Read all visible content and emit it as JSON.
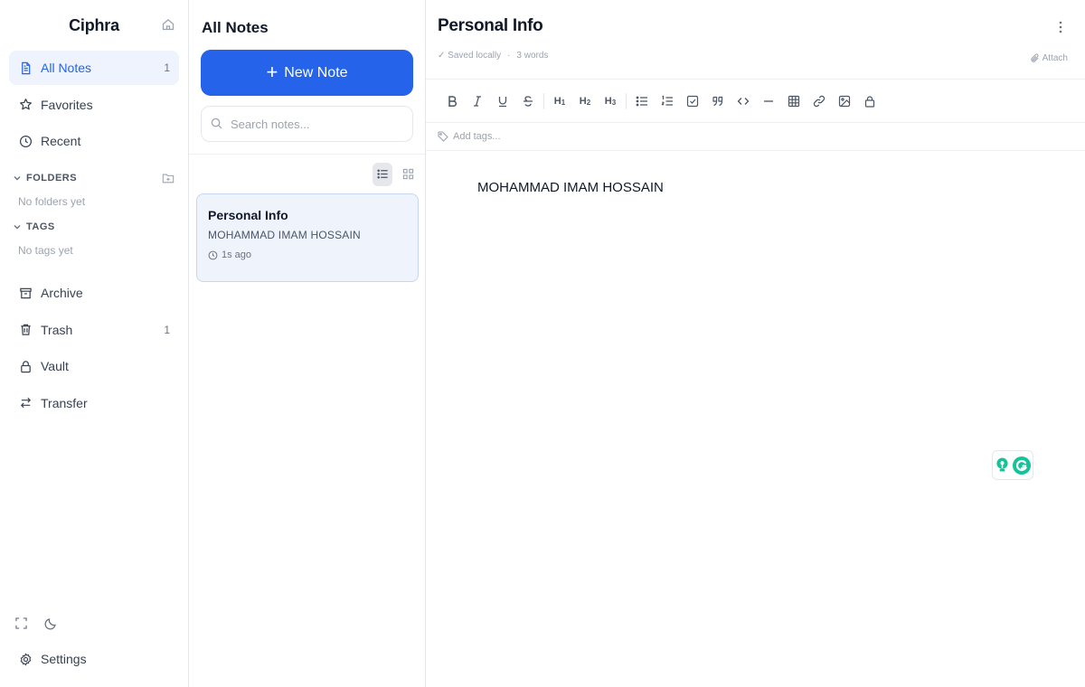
{
  "sidebar": {
    "app_title": "Ciphra",
    "nav": [
      {
        "label": "All Notes",
        "count": "1",
        "icon": "file-text-icon"
      },
      {
        "label": "Favorites",
        "count": "",
        "icon": "star-icon"
      },
      {
        "label": "Recent",
        "count": "",
        "icon": "clock-icon"
      }
    ],
    "folders": {
      "label": "FOLDERS",
      "empty": "No folders yet"
    },
    "tags": {
      "label": "TAGS",
      "empty": "No tags yet"
    },
    "nav2": [
      {
        "label": "Archive",
        "count": "",
        "icon": "archive-icon"
      },
      {
        "label": "Trash",
        "count": "1",
        "icon": "trash-icon"
      },
      {
        "label": "Vault",
        "count": "",
        "icon": "lock-icon"
      },
      {
        "label": "Transfer",
        "count": "",
        "icon": "transfer-icon"
      }
    ],
    "settings_label": "Settings"
  },
  "notelist": {
    "title": "All Notes",
    "new_note_label": "New Note",
    "search_placeholder": "Search notes...",
    "notes": [
      {
        "title": "Personal Info",
        "preview": "MOHAMMAD IMAM HOSSAIN",
        "time": "1s ago"
      }
    ]
  },
  "editor": {
    "title": "Personal Info",
    "saved": "✓ Saved locally",
    "separator": "·",
    "word_count": "3 words",
    "attach_label": "Attach",
    "tags_placeholder": "Add tags...",
    "content": "MOHAMMAD IMAM HOSSAIN",
    "toolbar_icons": [
      "bold-icon",
      "italic-icon",
      "underline-icon",
      "strikethrough-icon",
      "heading-1-icon",
      "heading-2-icon",
      "heading-3-icon",
      "bullet-list-icon",
      "numbered-list-icon",
      "checklist-icon",
      "quote-icon",
      "code-icon",
      "horizontal-rule-icon",
      "table-icon",
      "link-icon",
      "image-icon",
      "lock-icon"
    ]
  },
  "colors": {
    "accent": "#2563eb",
    "active_bg": "#eef3fd",
    "card_bg": "#eff4fc",
    "card_border": "#c7d6f3",
    "grammarly_green": "#15c39a"
  }
}
